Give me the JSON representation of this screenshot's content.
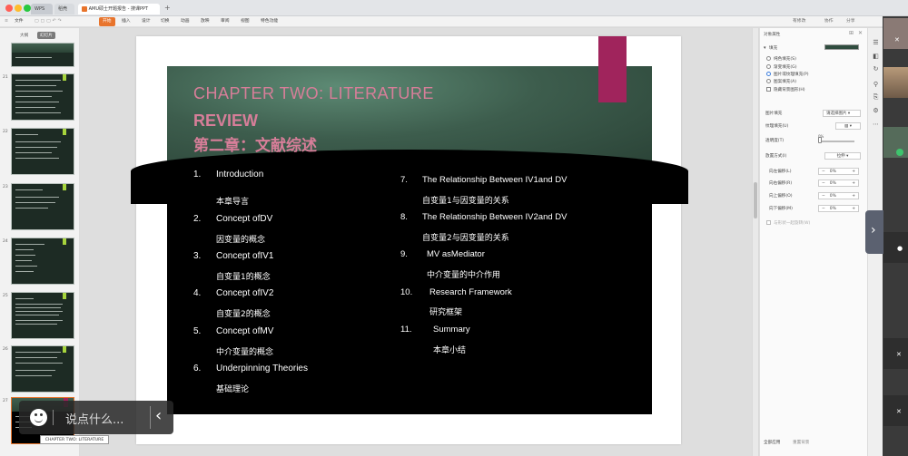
{
  "titlebar": {
    "tabs": [
      {
        "label": "WPS"
      },
      {
        "label": "稻壳"
      },
      {
        "label": "AMU硕士开题报告 - 搜课PPT"
      }
    ]
  },
  "menubar": {
    "file": "文件",
    "items": [
      "开始",
      "插入",
      "设计",
      "切换",
      "动画",
      "放映",
      "审阅",
      "视图",
      "特色功能"
    ],
    "right_items": [
      "有修改",
      "协作",
      "分享"
    ]
  },
  "leftpanel": {
    "tabs": [
      "大纲",
      "幻灯片"
    ],
    "slide_numbers": [
      "21",
      "22",
      "23",
      "24",
      "25",
      "26",
      "27"
    ]
  },
  "slide": {
    "title_line1": "CHAPTER TWO: LITERATURE",
    "title_line2": "REVIEW",
    "title_cn": "第二章：文献综述",
    "left_items": [
      {
        "num": "1.",
        "en": "Introduction",
        "cn": "本章导言"
      },
      {
        "num": "2.",
        "en": "Concept ofDV",
        "cn": "因变量的概念"
      },
      {
        "num": "3.",
        "en": "Concept ofIV1",
        "cn": "自变量1的概念"
      },
      {
        "num": "4.",
        "en": "Concept ofIV2",
        "cn": "自变量2的概念"
      },
      {
        "num": "5.",
        "en": "Concept ofMV",
        "cn": "中介变量的概念"
      },
      {
        "num": "6.",
        "en": "Underpinning Theories",
        "cn": "基础理论"
      }
    ],
    "right_items": [
      {
        "num": "7.",
        "en": "The Relationship Between IV1and DV",
        "cn": "自变量1与因变量的关系"
      },
      {
        "num": "8.",
        "en": "The Relationship Between IV2and DV",
        "cn": "自变量2与因变量的关系"
      },
      {
        "num": "9.",
        "en": "MV asMediator",
        "cn": "中介变量的中介作用"
      },
      {
        "num": "10.",
        "en": "Research Framework",
        "cn": "研究框架"
      },
      {
        "num": "11.",
        "en": "Summary",
        "cn": "本章小结"
      }
    ]
  },
  "rightpanel": {
    "header": "对象属性",
    "fill_label": "填充",
    "fill_options": [
      "纯色填充(S)",
      "渐变填充(G)",
      "图片或纹理填充(P)",
      "图案填充(A)"
    ],
    "hide_bg": "隐藏背景图形(H)",
    "picture_fill_label": "图片填充",
    "picture_fill_value": "请选择图片",
    "texture_label": "纹理填充(U)",
    "transparency_label": "透明度(T)",
    "transparency_value": "0%",
    "placement_label": "放置方式(I)",
    "placement_value": "拉伸",
    "offsets": [
      {
        "label": "向左偏移(L)",
        "value": "0%"
      },
      {
        "label": "向右偏移(R)",
        "value": "0%"
      },
      {
        "label": "向上偏移(O)",
        "value": "0%"
      },
      {
        "label": "向下偏移(M)",
        "value": "0%"
      }
    ],
    "rotate_with_shape": "与形状一起旋转(W)",
    "apply_all": "全部应用",
    "reset_bg": "重置背景"
  },
  "overlay": {
    "placeholder": "说点什么...",
    "tooltip": "CHAPTER TWO: LITERATURE"
  },
  "colors": {
    "title_pink": "#d77e99",
    "ribbon": "#a0245c",
    "accent_orange": "#e8742c"
  }
}
